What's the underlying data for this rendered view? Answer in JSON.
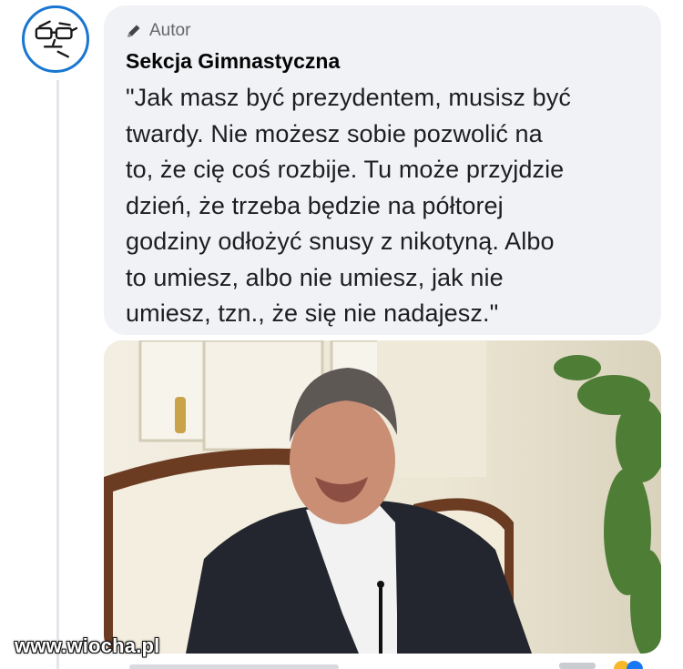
{
  "comment": {
    "author_badge": "Autor",
    "author_name": "Sekcja Gimnastyczna",
    "text": "\"Jak masz być prezydentem, musisz być\ntwardy. Nie możesz sobie pozwolić na\nto, że cię coś rozbije. Tu może przyjdzie\ndzień, że trzeba będzie na półtorej\ngodziny odłożyć snusy z nikotyną. Albo\nto umiesz, albo nie umiesz, jak nie\numiesz, tzn., że się nie nadajesz.\""
  },
  "icons": {
    "avatar": "nerd-face-avatar-icon",
    "badge": "pencil-icon"
  },
  "watermark": "www.wiocha.pl",
  "colors": {
    "avatar_ring": "#1976d2",
    "bubble_bg": "#f0f2f5",
    "badge_text": "#65676b"
  }
}
